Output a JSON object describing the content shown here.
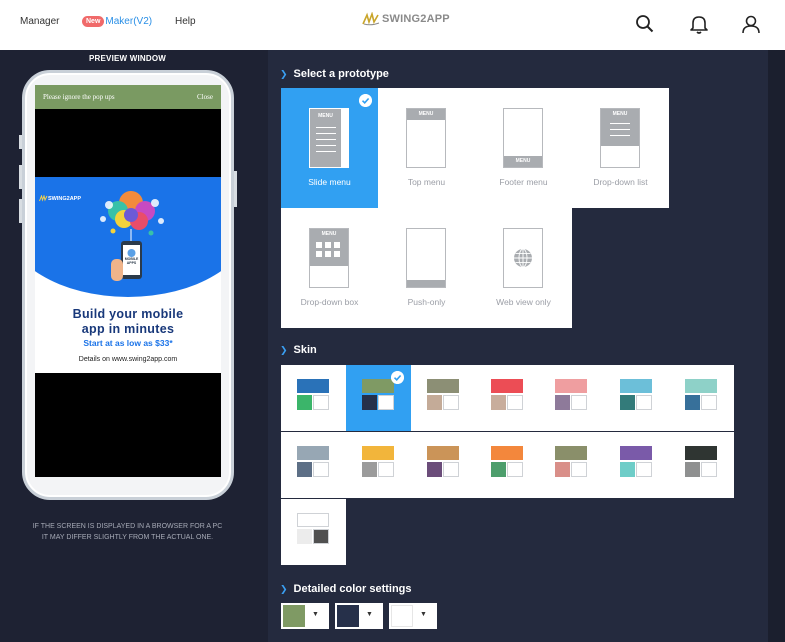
{
  "nav": {
    "manager": "Manager",
    "new_badge": "New",
    "maker": "Maker(V2)",
    "help": "Help",
    "logo": "SWING2APP",
    "icons": [
      "search-icon",
      "bell-icon",
      "user-icon"
    ]
  },
  "preview": {
    "title": "PREVIEW WINDOW",
    "popup_message": "Please ignore the pop ups",
    "popup_close": "Close",
    "ad_logo": "SWING2APP",
    "ad_phone_text": "MOBILE APPS",
    "ad_title_line1": "Build your mobile",
    "ad_title_line2": "app in minutes",
    "ad_price": "Start at as low as $33*",
    "ad_details": "Details on www.swing2app.com",
    "note_line1": "IF THE SCREEN IS DISPLAYED IN A BROWSER FOR A PC",
    "note_line2": "IT MAY DIFFER SLIGHTLY FROM THE ACTUAL ONE."
  },
  "prototype": {
    "title": "Select a prototype",
    "menu_text": "MENU",
    "items": [
      {
        "label": "Slide menu",
        "selected": true
      },
      {
        "label": "Top menu",
        "selected": false
      },
      {
        "label": "Footer menu",
        "selected": false
      },
      {
        "label": "Drop-down list",
        "selected": false
      },
      {
        "label": "Drop-down box",
        "selected": false
      },
      {
        "label": "Push-only",
        "selected": false
      },
      {
        "label": "Web view only",
        "selected": false
      }
    ]
  },
  "skin": {
    "title": "Skin",
    "selected_index": 1,
    "skins": [
      {
        "top": "#2a72b8",
        "left": "#3bb56a"
      },
      {
        "top": "#7f9a64",
        "left": "#26304a"
      },
      {
        "top": "#8c8f75",
        "left": "#c4ab98"
      },
      {
        "top": "#ec4d55",
        "left": "#c8ad9c"
      },
      {
        "top": "#ef9ea0",
        "left": "#8e7a9a"
      },
      {
        "top": "#6cbfd9",
        "left": "#337b7a"
      },
      {
        "top": "#8ed1c8",
        "left": "#37709a"
      },
      {
        "top": "#97a7b4",
        "left": "#5d6f86"
      },
      {
        "top": "#f2b53b",
        "left": "#9b9b9b"
      },
      {
        "top": "#cb9458",
        "left": "#6b4d7a"
      },
      {
        "top": "#f3873c",
        "left": "#4d9e6c"
      },
      {
        "top": "#8a8f6a",
        "left": "#d98f89"
      },
      {
        "top": "#7a5aa9",
        "left": "#6ecdc8"
      },
      {
        "top": "#2f3532",
        "left": "#8f9090"
      },
      {
        "top": "#ffffff",
        "left": "#ececec",
        "right": "#505050"
      }
    ]
  },
  "detailed": {
    "title": "Detailed color settings",
    "colors": [
      "#7f9a64",
      "#26304a",
      "#ffffff"
    ]
  }
}
